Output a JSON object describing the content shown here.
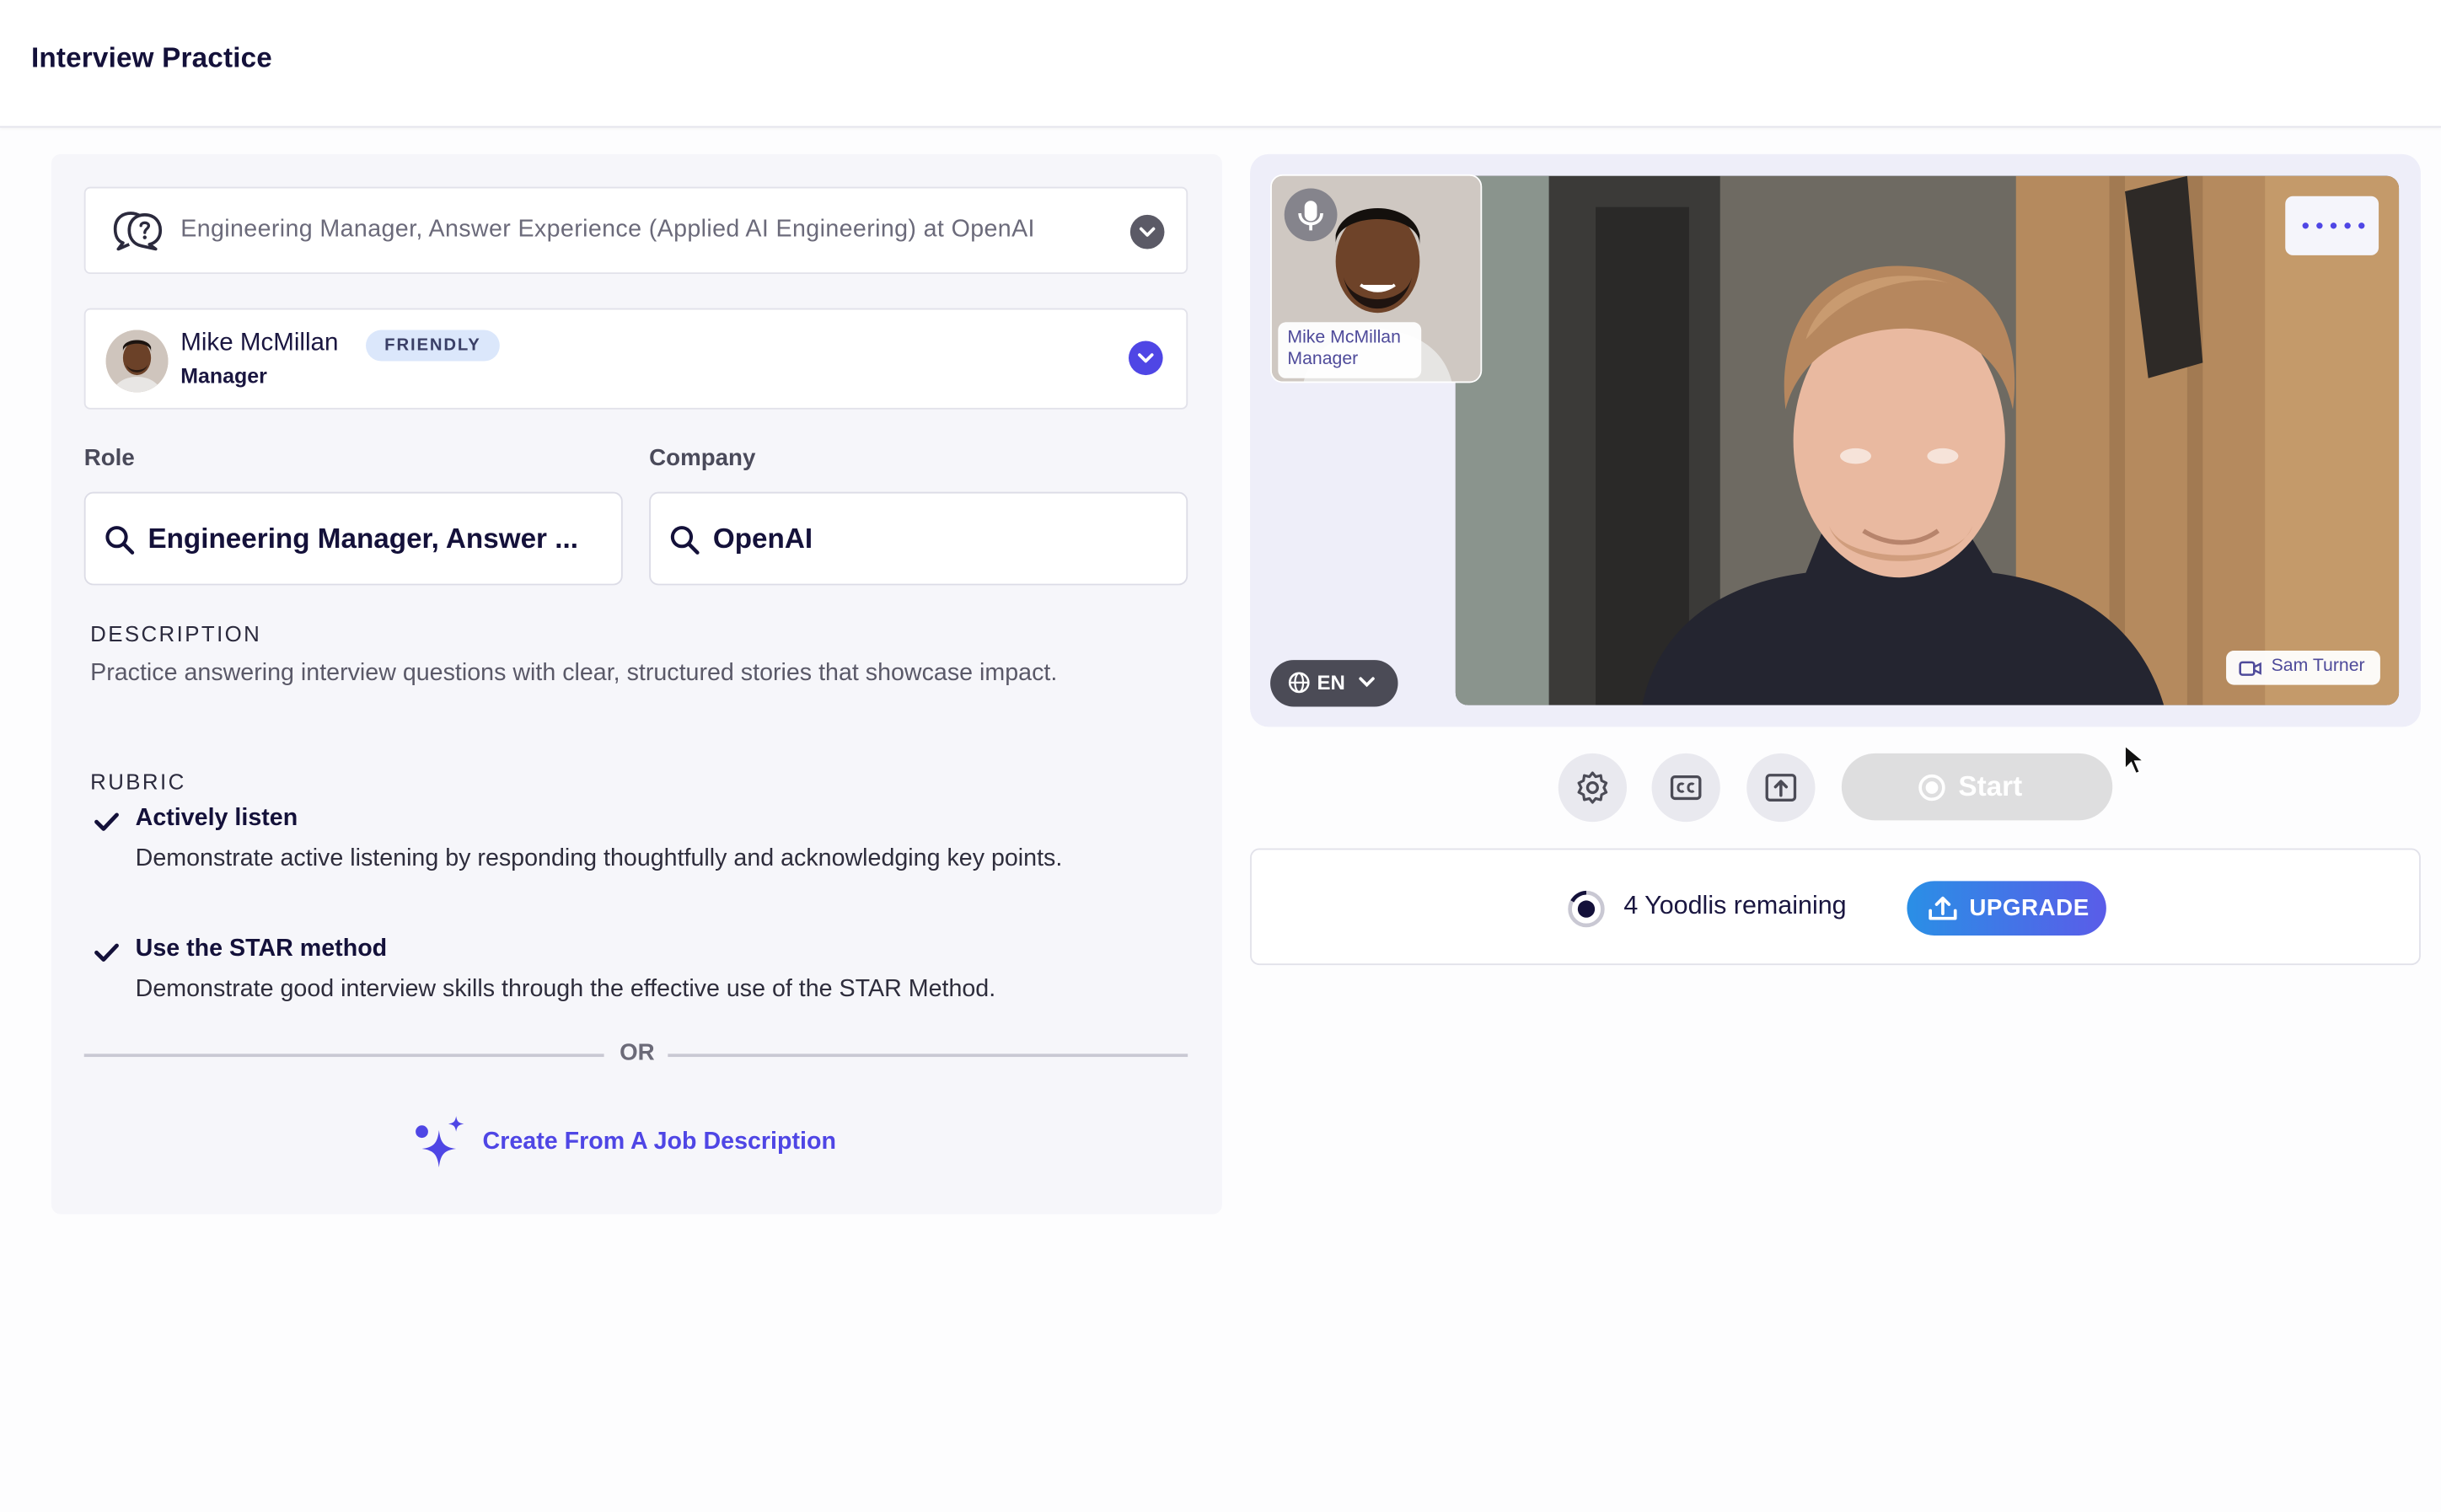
{
  "header": {
    "title": "Interview Practice"
  },
  "scenario": {
    "selected": "Engineering Manager, Answer Experience (Applied AI Engineering) at OpenAI",
    "icon": "question-bubble-icon"
  },
  "persona": {
    "name": "Mike McMillan",
    "badge": "FRIENDLY",
    "title": "Manager"
  },
  "role": {
    "label": "Role",
    "value": "Engineering Manager, Answer ..."
  },
  "company": {
    "label": "Company",
    "value": "OpenAI"
  },
  "description": {
    "heading": "DESCRIPTION",
    "text": "Practice answering interview questions with clear, structured stories that showcase impact."
  },
  "rubric": {
    "heading": "RUBRIC",
    "items": [
      {
        "title": "Actively listen",
        "description": "Demonstrate active listening by responding thoughtfully and acknowledging key points."
      },
      {
        "title": "Use the STAR method",
        "description": "Demonstrate good interview skills through the effective use of the STAR Method."
      }
    ]
  },
  "divider": {
    "text": "OR"
  },
  "job_description_link": {
    "label": "Create From A Job Description",
    "icon": "sparkles-icon"
  },
  "video": {
    "interviewer": {
      "name": "Mike McMillan",
      "title": "Manager"
    },
    "camera_label": "Sam Turner",
    "language": "EN"
  },
  "controls": {
    "start_label": "Start"
  },
  "quota": {
    "remaining_text": "4 Yoodlis remaining",
    "upgrade_label": "UPGRADE"
  },
  "colors": {
    "accent": "#4f46e5",
    "upgrade_start": "#2a8fe6",
    "upgrade_end": "#5a5ce8"
  }
}
